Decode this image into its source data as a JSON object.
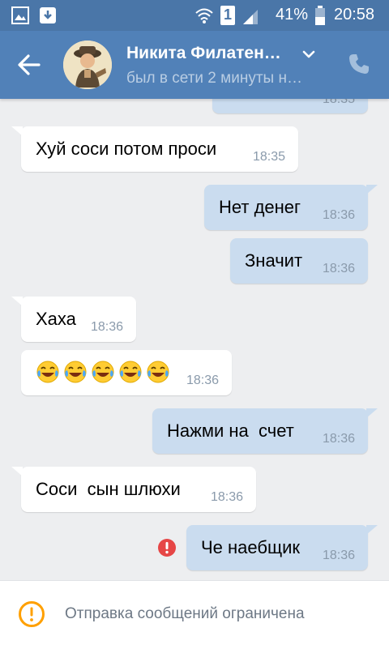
{
  "status_bar": {
    "battery_percent": "41%",
    "time": "20:58",
    "sim_number": "1"
  },
  "header": {
    "contact_name": "Никита Филатен…",
    "status": "был в сети 2 минуты н…"
  },
  "messages": [
    {
      "direction": "out",
      "text": "",
      "time": "18:35"
    },
    {
      "direction": "in",
      "text": "Хуй соси потом проси",
      "time": "18:35"
    },
    {
      "direction": "out",
      "text": "Нет денег",
      "time": "18:36"
    },
    {
      "direction": "out",
      "text": "Значит",
      "time": "18:36"
    },
    {
      "direction": "in",
      "text": "Хаха",
      "time": "18:36"
    },
    {
      "direction": "in",
      "text": "",
      "emoji": [
        "tears-of-joy",
        "tears-of-joy",
        "tears-of-joy",
        "tears-of-joy",
        "tears-of-joy"
      ],
      "time": "18:36"
    },
    {
      "direction": "out",
      "text": "Нажми на  счет",
      "time": "18:36"
    },
    {
      "direction": "in",
      "text": "Соси  сын шлюхи",
      "time": "18:36"
    },
    {
      "direction": "out",
      "text": "Че наебщик",
      "time": "18:36",
      "error": true
    }
  ],
  "footer": {
    "notice": "Отправка сообщений ограничена"
  },
  "colors": {
    "header": "#5181b8",
    "status_bar": "#4a76a8",
    "outgoing_bubble": "#cadcef",
    "incoming_bubble": "#ffffff",
    "background": "#edeef0",
    "error": "#e64646",
    "warning": "#ffa000"
  }
}
